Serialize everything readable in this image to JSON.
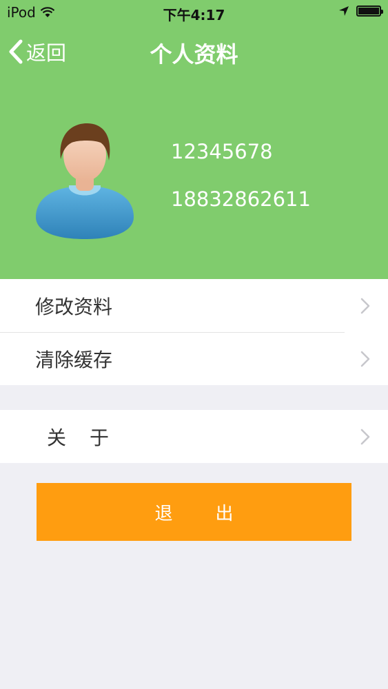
{
  "status_bar": {
    "carrier": "iPod",
    "time": "下午4:17",
    "battery_level": 1.0
  },
  "nav": {
    "back_label": "返回",
    "title": "个人资料"
  },
  "profile": {
    "account_id": "12345678",
    "phone": "18832862611"
  },
  "menu": {
    "group1": [
      {
        "label": "修改资料"
      },
      {
        "label": "清除缓存"
      }
    ],
    "group2": [
      {
        "label": "关于"
      }
    ]
  },
  "logout_label": "退出",
  "colors": {
    "header_green": "#80cc6d",
    "logout_orange": "#ff9d10",
    "background": "#efeff4",
    "chevron": "#c7c7cc"
  },
  "icons": [
    "wifi-icon",
    "location-arrow-icon",
    "battery-icon",
    "back-chevron-icon",
    "avatar-icon",
    "chevron-right-icon"
  ]
}
